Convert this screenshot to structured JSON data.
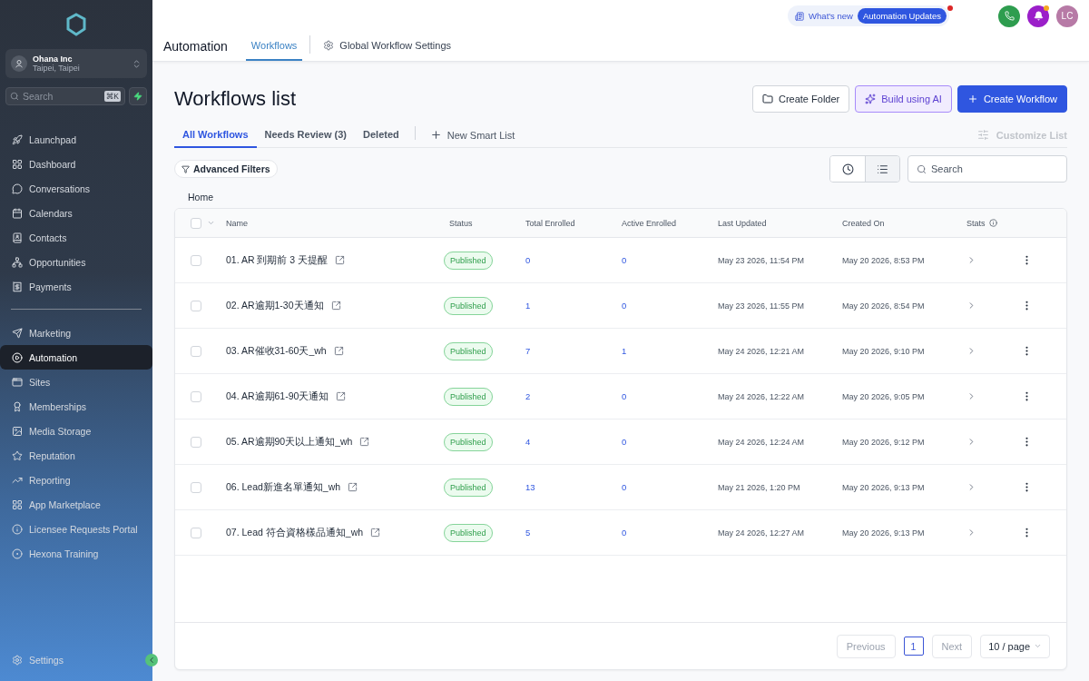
{
  "sidebar": {
    "account": {
      "name": "Ohana Inc",
      "location": "Taipei, Taipei"
    },
    "search": {
      "placeholder": "Search",
      "shortcut": "⌘K"
    },
    "items": [
      {
        "label": "Launchpad",
        "selected": false
      },
      {
        "label": "Dashboard",
        "selected": false
      },
      {
        "label": "Conversations",
        "selected": false
      },
      {
        "label": "Calendars",
        "selected": false
      },
      {
        "label": "Contacts",
        "selected": false
      },
      {
        "label": "Opportunities",
        "selected": false
      },
      {
        "label": "Payments",
        "selected": false
      }
    ],
    "lower_items": [
      {
        "label": "Marketing",
        "selected": false
      },
      {
        "label": "Automation",
        "selected": true
      },
      {
        "label": "Sites",
        "selected": false
      },
      {
        "label": "Memberships",
        "selected": false
      },
      {
        "label": "Media Storage",
        "selected": false
      },
      {
        "label": "Reputation",
        "selected": false
      },
      {
        "label": "Reporting",
        "selected": false
      },
      {
        "label": "App Marketplace",
        "selected": false
      },
      {
        "label": "Licensee Requests Portal",
        "selected": false
      },
      {
        "label": "Hexona Training",
        "selected": false
      }
    ],
    "settings": {
      "label": "Settings"
    }
  },
  "header": {
    "title": "Automation",
    "tabs": [
      {
        "label": "Workflows",
        "selected": true
      },
      {
        "label": "Global Workflow Settings",
        "selected": false
      }
    ],
    "whats_new": {
      "label": "What's new",
      "badge": "Automation Updates",
      "unread": true
    },
    "notifications_unread": true,
    "avatar": "LC"
  },
  "page": {
    "title": "Workflows list",
    "actions": [
      {
        "label": "Create Folder",
        "kind": "folder"
      },
      {
        "label": "Build using AI",
        "kind": "ai"
      },
      {
        "label": "Create Workflow",
        "kind": "primary"
      }
    ],
    "list_tabs": [
      {
        "label": "All Workflows",
        "selected": true
      },
      {
        "label": "Needs Review (3)",
        "selected": false
      },
      {
        "label": "Deleted",
        "selected": false
      }
    ],
    "new_smart_list": "New Smart List",
    "customize_list": {
      "label": "Customize List",
      "disabled": true
    },
    "advanced_filters": "Advanced Filters",
    "views": [
      {
        "kind": "clock",
        "selected": false
      },
      {
        "kind": "list",
        "selected": true
      }
    ],
    "search": {
      "placeholder": "Search"
    },
    "breadcrumb": "Home"
  },
  "table": {
    "all_checked": false,
    "columns": [
      "Name",
      "Status",
      "Total Enrolled",
      "Active Enrolled",
      "Last Updated",
      "Created On",
      "Stats"
    ],
    "rows": [
      {
        "checked": false,
        "name": "01. AR 到期前 3 天提醒",
        "status": {
          "label": "Published",
          "kind": "published"
        },
        "total": "0",
        "active": "0",
        "last_updated": "May 23 2026, 11:54 PM",
        "created_on": "May 20 2026, 8:53 PM"
      },
      {
        "checked": false,
        "name": "02. AR逾期1-30天通知",
        "status": {
          "label": "Published",
          "kind": "published"
        },
        "total": "1",
        "active": "0",
        "last_updated": "May 23 2026, 11:55 PM",
        "created_on": "May 20 2026, 8:54 PM"
      },
      {
        "checked": false,
        "name": "03. AR催收31-60天_wh",
        "status": {
          "label": "Published",
          "kind": "published"
        },
        "total": "7",
        "active": "1",
        "last_updated": "May 24 2026, 12:21 AM",
        "created_on": "May 20 2026, 9:10 PM"
      },
      {
        "checked": false,
        "name": "04. AR逾期61-90天通知",
        "status": {
          "label": "Published",
          "kind": "published"
        },
        "total": "2",
        "active": "0",
        "last_updated": "May 24 2026, 12:22 AM",
        "created_on": "May 20 2026, 9:05 PM"
      },
      {
        "checked": false,
        "name": "05. AR逾期90天以上通知_wh",
        "status": {
          "label": "Published",
          "kind": "published"
        },
        "total": "4",
        "active": "0",
        "last_updated": "May 24 2026, 12:24 AM",
        "created_on": "May 20 2026, 9:12 PM"
      },
      {
        "checked": false,
        "name": "06. Lead新進名單通知_wh",
        "status": {
          "label": "Published",
          "kind": "published"
        },
        "total": "13",
        "active": "0",
        "last_updated": "May 21 2026, 1:20 PM",
        "created_on": "May 20 2026, 9:13 PM"
      },
      {
        "checked": false,
        "name": "07. Lead 符合資格樣品通知_wh",
        "status": {
          "label": "Published",
          "kind": "published"
        },
        "total": "5",
        "active": "0",
        "last_updated": "May 24 2026, 12:27 AM",
        "created_on": "May 20 2026, 9:13 PM"
      }
    ]
  },
  "pagination": {
    "previous": {
      "label": "Previous",
      "disabled": true
    },
    "pages": [
      {
        "label": "1",
        "selected": true
      }
    ],
    "next": {
      "label": "Next",
      "disabled": true
    },
    "page_size": "10 / page"
  }
}
